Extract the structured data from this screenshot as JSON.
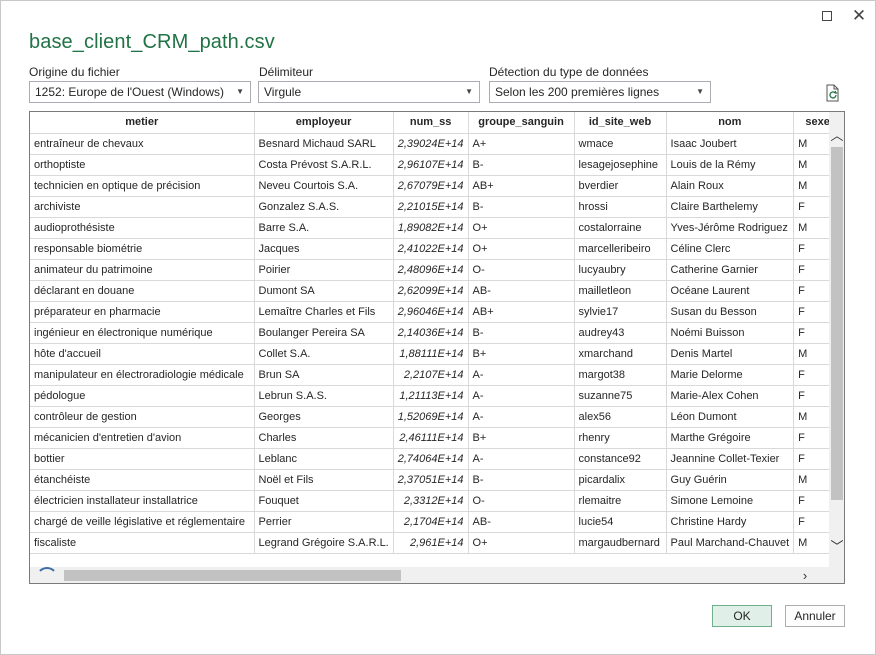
{
  "window": {
    "title": "base_client_CRM_path.csv",
    "maximize_icon": "maximize-icon",
    "close_glyph": "✕"
  },
  "options": {
    "origin": {
      "label": "Origine du fichier",
      "value": "1252: Europe de l'Ouest (Windows)"
    },
    "delimiter": {
      "label": "Délimiteur",
      "value": "Virgule"
    },
    "detection": {
      "label": "Détection du type de données",
      "value": "Selon les 200 premières lignes"
    },
    "refresh_icon": "refresh-document-icon"
  },
  "table": {
    "columns": [
      "metier",
      "employeur",
      "num_ss",
      "groupe_sanguin",
      "id_site_web",
      "nom",
      "sexe"
    ],
    "rows": [
      [
        "entraîneur de chevaux",
        "Besnard Michaud SARL",
        "2,39024E+14",
        "A+",
        "wmace",
        "Isaac Joubert",
        "M"
      ],
      [
        "orthoptiste",
        "Costa Prévost S.A.R.L.",
        "2,96107E+14",
        "B-",
        "lesagejosephine",
        "Louis de la Rémy",
        "M"
      ],
      [
        "technicien en optique de précision",
        "Neveu Courtois S.A.",
        "2,67079E+14",
        "AB+",
        "bverdier",
        "Alain Roux",
        "M"
      ],
      [
        "archiviste",
        "Gonzalez S.A.S.",
        "2,21015E+14",
        "B-",
        "hrossi",
        "Claire Barthelemy",
        "F"
      ],
      [
        "audioprothésiste",
        "Barre S.A.",
        "1,89082E+14",
        "O+",
        "costalorraine",
        "Yves-Jérôme Rodriguez",
        "M"
      ],
      [
        "responsable biométrie",
        "Jacques",
        "2,41022E+14",
        "O+",
        "marcelleribeiro",
        "Céline Clerc",
        "F"
      ],
      [
        "animateur du patrimoine",
        "Poirier",
        "2,48096E+14",
        "O-",
        "lucyaubry",
        "Catherine Garnier",
        "F"
      ],
      [
        "déclarant en douane",
        "Dumont SA",
        "2,62099E+14",
        "AB-",
        "mailletleon",
        "Océane Laurent",
        "F"
      ],
      [
        "préparateur en pharmacie",
        "Lemaître Charles et Fils",
        "2,96046E+14",
        "AB+",
        "sylvie17",
        "Susan du Besson",
        "F"
      ],
      [
        "ingénieur en électronique numérique",
        "Boulanger Pereira SA",
        "2,14036E+14",
        "B-",
        "audrey43",
        "Noémi Buisson",
        "F"
      ],
      [
        "hôte d'accueil",
        "Collet S.A.",
        "1,88111E+14",
        "B+",
        "xmarchand",
        "Denis Martel",
        "M"
      ],
      [
        "manipulateur en électroradiologie médicale",
        "Brun SA",
        "2,2107E+14",
        "A-",
        "margot38",
        "Marie Delorme",
        "F"
      ],
      [
        "pédologue",
        "Lebrun S.A.S.",
        "1,21113E+14",
        "A-",
        "suzanne75",
        "Marie-Alex Cohen",
        "F"
      ],
      [
        "contrôleur de gestion",
        "Georges",
        "1,52069E+14",
        "A-",
        "alex56",
        "Léon Dumont",
        "M"
      ],
      [
        "mécanicien d'entretien d'avion",
        "Charles",
        "2,46111E+14",
        "B+",
        "rhenry",
        "Marthe Grégoire",
        "F"
      ],
      [
        "bottier",
        "Leblanc",
        "2,74064E+14",
        "A-",
        "constance92",
        "Jeannine Collet-Texier",
        "F"
      ],
      [
        "étanchéiste",
        "Noël et Fils",
        "2,37051E+14",
        "B-",
        "picardalix",
        "Guy Guérin",
        "M"
      ],
      [
        "électricien installateur installatrice",
        "Fouquet",
        "2,3312E+14",
        "O-",
        "rlemaitre",
        "Simone Lemoine",
        "F"
      ],
      [
        "chargé de veille législative et réglementaire",
        "Perrier",
        "2,1704E+14",
        "AB-",
        "lucie54",
        "Christine Hardy",
        "F"
      ],
      [
        "fiscaliste",
        "Legrand Grégoire S.A.R.L.",
        "2,961E+14",
        "O+",
        "margaudbernard",
        "Paul Marchand-Chauvet",
        "M"
      ]
    ]
  },
  "buttons": {
    "ok": "OK",
    "cancel": "Annuler"
  }
}
